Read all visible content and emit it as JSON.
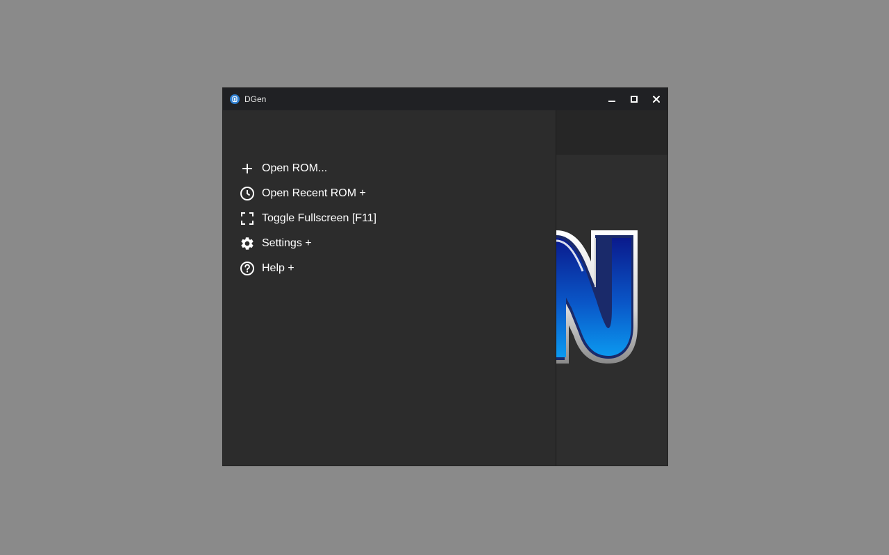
{
  "window": {
    "title": "DGen"
  },
  "menu": {
    "items": [
      {
        "label": "Open ROM...",
        "icon": "plus-icon"
      },
      {
        "label": "Open Recent ROM +",
        "icon": "clock-icon"
      },
      {
        "label": "Toggle Fullscreen [F11]",
        "icon": "fullscreen-icon"
      },
      {
        "label": "Settings +",
        "icon": "gear-icon"
      },
      {
        "label": "Help +",
        "icon": "help-icon"
      }
    ]
  },
  "colors": {
    "titlebar": "#202124",
    "menu_bg": "#2c2c2c",
    "text": "#ffffff",
    "logo_blue": "#1565d8"
  }
}
